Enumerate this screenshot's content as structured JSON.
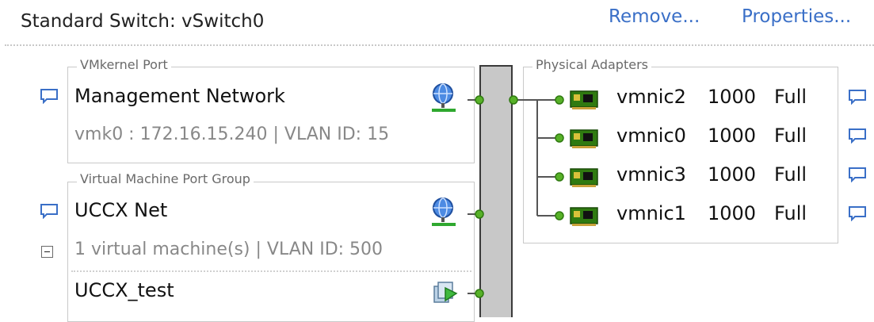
{
  "header": {
    "title": "Standard Switch: vSwitch0",
    "remove_label": "Remove...",
    "properties_label": "Properties..."
  },
  "vmkernel": {
    "legend": "VMkernel Port",
    "name": "Management Network",
    "detail": "vmk0 : 172.16.15.240 | VLAN ID: 15"
  },
  "vm_port_group": {
    "legend": "Virtual Machine Port Group",
    "name": "UCCX Net",
    "detail": "1 virtual machine(s) | VLAN ID: 500",
    "vms": [
      "UCCX_test"
    ]
  },
  "physical_adapters": {
    "legend": "Physical Adapters",
    "adapters": [
      {
        "name": "vmnic2",
        "speed": "1000",
        "duplex": "Full"
      },
      {
        "name": "vmnic0",
        "speed": "1000",
        "duplex": "Full"
      },
      {
        "name": "vmnic3",
        "speed": "1000",
        "duplex": "Full"
      },
      {
        "name": "vmnic1",
        "speed": "1000",
        "duplex": "Full"
      }
    ]
  },
  "colors": {
    "link": "#3a6fc7",
    "connector": "#6aaa2a",
    "switch_bar": "#c8c8c8"
  },
  "icons": {
    "info": "speech-bubble-icon",
    "network": "globe-network-icon",
    "nic": "nic-card-icon",
    "vm": "virtual-machine-icon"
  }
}
